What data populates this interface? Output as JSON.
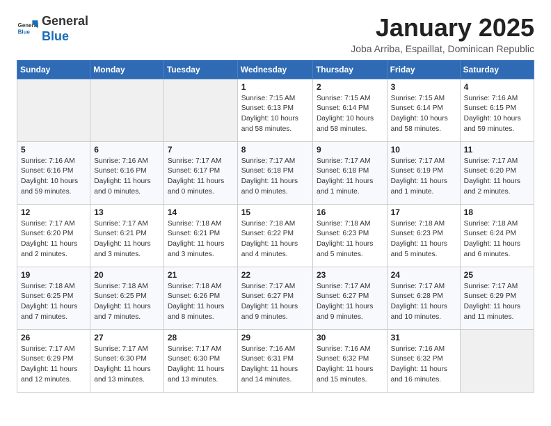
{
  "header": {
    "logo_general": "General",
    "logo_blue": "Blue",
    "month_title": "January 2025",
    "subtitle": "Joba Arriba, Espaillat, Dominican Republic"
  },
  "weekdays": [
    "Sunday",
    "Monday",
    "Tuesday",
    "Wednesday",
    "Thursday",
    "Friday",
    "Saturday"
  ],
  "weeks": [
    [
      {
        "day": "",
        "info": ""
      },
      {
        "day": "",
        "info": ""
      },
      {
        "day": "",
        "info": ""
      },
      {
        "day": "1",
        "info": "Sunrise: 7:15 AM\nSunset: 6:13 PM\nDaylight: 10 hours\nand 58 minutes."
      },
      {
        "day": "2",
        "info": "Sunrise: 7:15 AM\nSunset: 6:14 PM\nDaylight: 10 hours\nand 58 minutes."
      },
      {
        "day": "3",
        "info": "Sunrise: 7:15 AM\nSunset: 6:14 PM\nDaylight: 10 hours\nand 58 minutes."
      },
      {
        "day": "4",
        "info": "Sunrise: 7:16 AM\nSunset: 6:15 PM\nDaylight: 10 hours\nand 59 minutes."
      }
    ],
    [
      {
        "day": "5",
        "info": "Sunrise: 7:16 AM\nSunset: 6:16 PM\nDaylight: 10 hours\nand 59 minutes."
      },
      {
        "day": "6",
        "info": "Sunrise: 7:16 AM\nSunset: 6:16 PM\nDaylight: 11 hours\nand 0 minutes."
      },
      {
        "day": "7",
        "info": "Sunrise: 7:17 AM\nSunset: 6:17 PM\nDaylight: 11 hours\nand 0 minutes."
      },
      {
        "day": "8",
        "info": "Sunrise: 7:17 AM\nSunset: 6:18 PM\nDaylight: 11 hours\nand 0 minutes."
      },
      {
        "day": "9",
        "info": "Sunrise: 7:17 AM\nSunset: 6:18 PM\nDaylight: 11 hours\nand 1 minute."
      },
      {
        "day": "10",
        "info": "Sunrise: 7:17 AM\nSunset: 6:19 PM\nDaylight: 11 hours\nand 1 minute."
      },
      {
        "day": "11",
        "info": "Sunrise: 7:17 AM\nSunset: 6:20 PM\nDaylight: 11 hours\nand 2 minutes."
      }
    ],
    [
      {
        "day": "12",
        "info": "Sunrise: 7:17 AM\nSunset: 6:20 PM\nDaylight: 11 hours\nand 2 minutes."
      },
      {
        "day": "13",
        "info": "Sunrise: 7:17 AM\nSunset: 6:21 PM\nDaylight: 11 hours\nand 3 minutes."
      },
      {
        "day": "14",
        "info": "Sunrise: 7:18 AM\nSunset: 6:21 PM\nDaylight: 11 hours\nand 3 minutes."
      },
      {
        "day": "15",
        "info": "Sunrise: 7:18 AM\nSunset: 6:22 PM\nDaylight: 11 hours\nand 4 minutes."
      },
      {
        "day": "16",
        "info": "Sunrise: 7:18 AM\nSunset: 6:23 PM\nDaylight: 11 hours\nand 5 minutes."
      },
      {
        "day": "17",
        "info": "Sunrise: 7:18 AM\nSunset: 6:23 PM\nDaylight: 11 hours\nand 5 minutes."
      },
      {
        "day": "18",
        "info": "Sunrise: 7:18 AM\nSunset: 6:24 PM\nDaylight: 11 hours\nand 6 minutes."
      }
    ],
    [
      {
        "day": "19",
        "info": "Sunrise: 7:18 AM\nSunset: 6:25 PM\nDaylight: 11 hours\nand 7 minutes."
      },
      {
        "day": "20",
        "info": "Sunrise: 7:18 AM\nSunset: 6:25 PM\nDaylight: 11 hours\nand 7 minutes."
      },
      {
        "day": "21",
        "info": "Sunrise: 7:18 AM\nSunset: 6:26 PM\nDaylight: 11 hours\nand 8 minutes."
      },
      {
        "day": "22",
        "info": "Sunrise: 7:17 AM\nSunset: 6:27 PM\nDaylight: 11 hours\nand 9 minutes."
      },
      {
        "day": "23",
        "info": "Sunrise: 7:17 AM\nSunset: 6:27 PM\nDaylight: 11 hours\nand 9 minutes."
      },
      {
        "day": "24",
        "info": "Sunrise: 7:17 AM\nSunset: 6:28 PM\nDaylight: 11 hours\nand 10 minutes."
      },
      {
        "day": "25",
        "info": "Sunrise: 7:17 AM\nSunset: 6:29 PM\nDaylight: 11 hours\nand 11 minutes."
      }
    ],
    [
      {
        "day": "26",
        "info": "Sunrise: 7:17 AM\nSunset: 6:29 PM\nDaylight: 11 hours\nand 12 minutes."
      },
      {
        "day": "27",
        "info": "Sunrise: 7:17 AM\nSunset: 6:30 PM\nDaylight: 11 hours\nand 13 minutes."
      },
      {
        "day": "28",
        "info": "Sunrise: 7:17 AM\nSunset: 6:30 PM\nDaylight: 11 hours\nand 13 minutes."
      },
      {
        "day": "29",
        "info": "Sunrise: 7:16 AM\nSunset: 6:31 PM\nDaylight: 11 hours\nand 14 minutes."
      },
      {
        "day": "30",
        "info": "Sunrise: 7:16 AM\nSunset: 6:32 PM\nDaylight: 11 hours\nand 15 minutes."
      },
      {
        "day": "31",
        "info": "Sunrise: 7:16 AM\nSunset: 6:32 PM\nDaylight: 11 hours\nand 16 minutes."
      },
      {
        "day": "",
        "info": ""
      }
    ]
  ]
}
